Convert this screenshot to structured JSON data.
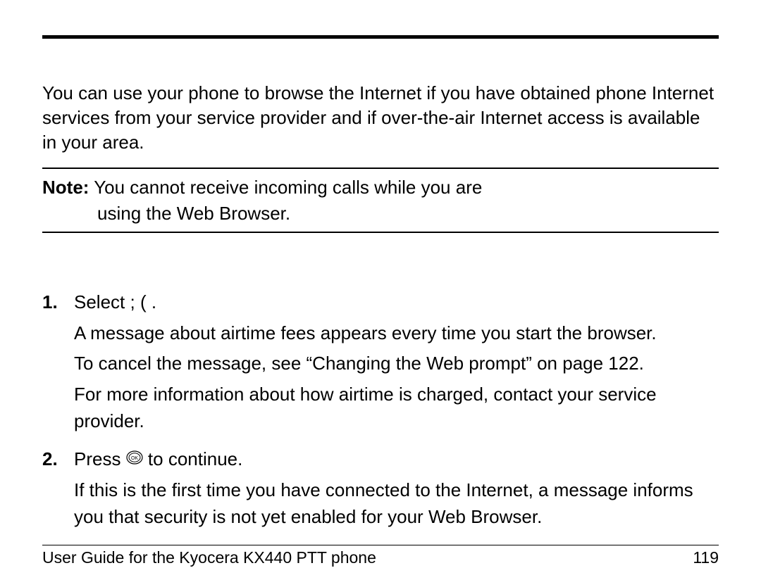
{
  "intro": "You can use your phone to browse the Internet if you have obtained phone Internet services from your service provider and if over-the-air Internet access is available in your area.",
  "note_label": "Note:",
  "note_line1": " You cannot receive incoming calls while you are",
  "note_line2": "using the Web Browser.",
  "steps": {
    "step1": {
      "num": "1.",
      "line_a_pre": "Select ",
      "line_a_mid": "             ; ",
      "line_a_post": "  (              .",
      "line_b": "A message about airtime fees appears every time you start the browser.",
      "line_c": "To cancel the message, see “Changing the Web prompt” on page 122.",
      "line_d": "For more information about how airtime is charged, contact your service provider."
    },
    "step2": {
      "num": "2.",
      "line_a_pre": "Press ",
      "line_a_post": " to continue.",
      "line_b": "If this is the first time you have connected to the Internet, a message informs you that security is not yet enabled for your Web Browser."
    }
  },
  "footer": {
    "title": "User Guide for the Kyocera KX440 PTT phone",
    "page": "119"
  }
}
